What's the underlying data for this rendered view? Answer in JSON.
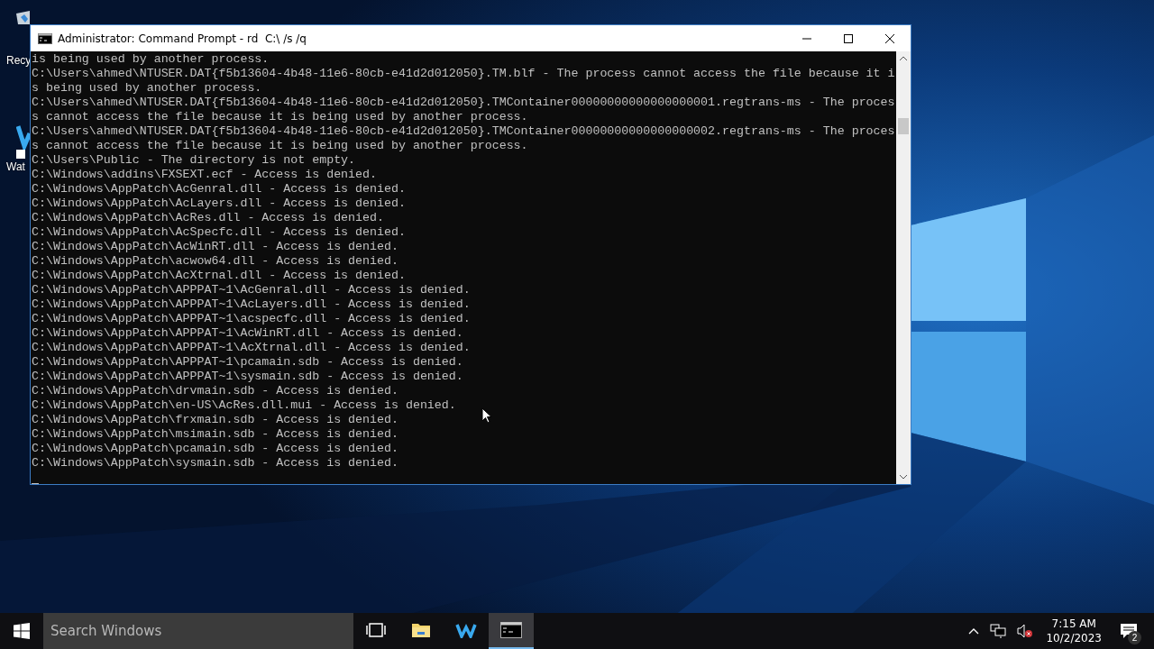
{
  "desktop_icons": [
    {
      "kind": "recycle-bin",
      "label": "Recy"
    },
    {
      "kind": "app",
      "label": "Wat"
    }
  ],
  "window": {
    "title": "Administrator: Command Prompt - rd  C:\\ /s /q",
    "console_lines": [
      "is being used by another process.",
      "C:\\Users\\ahmed\\NTUSER.DAT{f5b13604-4b48-11e6-80cb-e41d2d012050}.TM.blf - The process cannot access the file because it i",
      "s being used by another process.",
      "C:\\Users\\ahmed\\NTUSER.DAT{f5b13604-4b48-11e6-80cb-e41d2d012050}.TMContainer00000000000000000001.regtrans-ms - The proces",
      "s cannot access the file because it is being used by another process.",
      "C:\\Users\\ahmed\\NTUSER.DAT{f5b13604-4b48-11e6-80cb-e41d2d012050}.TMContainer00000000000000000002.regtrans-ms - The proces",
      "s cannot access the file because it is being used by another process.",
      "C:\\Users\\Public - The directory is not empty.",
      "C:\\Windows\\addins\\FXSEXT.ecf - Access is denied.",
      "C:\\Windows\\AppPatch\\AcGenral.dll - Access is denied.",
      "C:\\Windows\\AppPatch\\AcLayers.dll - Access is denied.",
      "C:\\Windows\\AppPatch\\AcRes.dll - Access is denied.",
      "C:\\Windows\\AppPatch\\AcSpecfc.dll - Access is denied.",
      "C:\\Windows\\AppPatch\\AcWinRT.dll - Access is denied.",
      "C:\\Windows\\AppPatch\\acwow64.dll - Access is denied.",
      "C:\\Windows\\AppPatch\\AcXtrnal.dll - Access is denied.",
      "C:\\Windows\\AppPatch\\APPPAT~1\\AcGenral.dll - Access is denied.",
      "C:\\Windows\\AppPatch\\APPPAT~1\\AcLayers.dll - Access is denied.",
      "C:\\Windows\\AppPatch\\APPPAT~1\\acspecfc.dll - Access is denied.",
      "C:\\Windows\\AppPatch\\APPPAT~1\\AcWinRT.dll - Access is denied.",
      "C:\\Windows\\AppPatch\\APPPAT~1\\AcXtrnal.dll - Access is denied.",
      "C:\\Windows\\AppPatch\\APPPAT~1\\pcamain.sdb - Access is denied.",
      "C:\\Windows\\AppPatch\\APPPAT~1\\sysmain.sdb - Access is denied.",
      "C:\\Windows\\AppPatch\\drvmain.sdb - Access is denied.",
      "C:\\Windows\\AppPatch\\en-US\\AcRes.dll.mui - Access is denied.",
      "C:\\Windows\\AppPatch\\frxmain.sdb - Access is denied.",
      "C:\\Windows\\AppPatch\\msimain.sdb - Access is denied.",
      "C:\\Windows\\AppPatch\\pcamain.sdb - Access is denied.",
      "C:\\Windows\\AppPatch\\sysmain.sdb - Access is denied."
    ]
  },
  "taskbar": {
    "search": {
      "placeholder": "Search Windows"
    },
    "apps": [
      {
        "kind": "task-view",
        "selected": false
      },
      {
        "kind": "folder",
        "selected": false
      },
      {
        "kind": "app",
        "selected": false
      },
      {
        "kind": "console",
        "selected": true
      }
    ],
    "clock": {
      "time": "7:15 AM",
      "date": "10/2/2023"
    },
    "notifications": {
      "count": "2"
    }
  }
}
